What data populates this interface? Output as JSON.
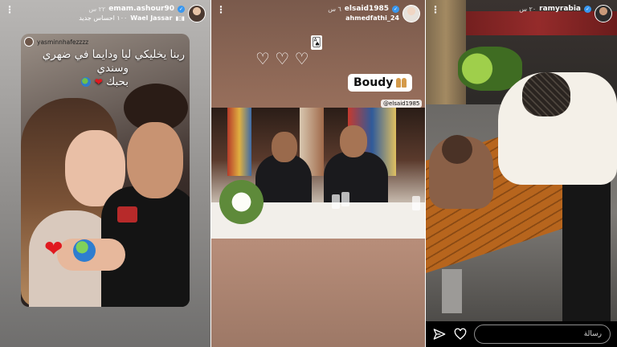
{
  "stories": [
    {
      "username": "emam.ashour90",
      "time": "٢٢ س",
      "music_label": "Wael Jassar",
      "music_meta": "١٠٠ احساس جديد",
      "mention_user": "yasminnhafezzzz",
      "caption_line1": "ربنا يخليكي ليا ودايما في ضهري",
      "caption_line2": "وسندي",
      "caption_line3": "بحبك"
    },
    {
      "username": "elsaid1985",
      "time": "٦ س",
      "collab_user": "ahmedfathi_24",
      "card_emoji": "🂡",
      "hearts": "♡ ♡ ♡",
      "name_label": "Boudy",
      "mention_tag": "@elsaid1985"
    },
    {
      "username": "ramyrabia",
      "time": "٢٠ س",
      "reply_placeholder": "رسالة"
    }
  ],
  "icons": {
    "more": "vertical-dots-icon",
    "verified": "verified-badge-icon",
    "music": "music-bars-icon",
    "send": "send-icon",
    "like": "heart-outline-icon"
  },
  "colors": {
    "verified": "#3897f0",
    "heart": "#e0191f"
  }
}
